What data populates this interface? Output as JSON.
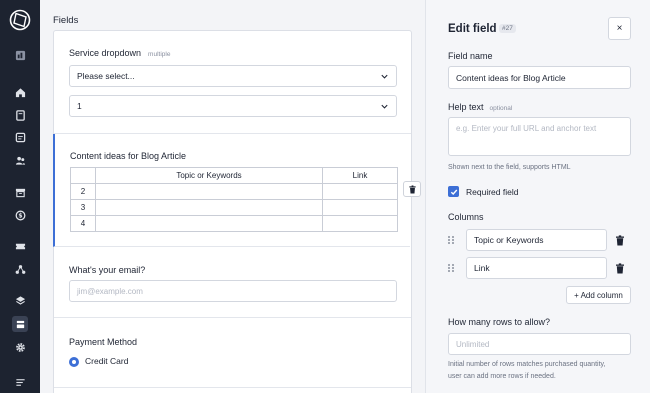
{
  "main": {
    "fields_title": "Fields",
    "service": {
      "label": "Service dropdown",
      "tag": "multiple",
      "select_value": "Please select...",
      "quantity_value": "1"
    },
    "content": {
      "label": "Content ideas for Blog Article",
      "columns": [
        "Topic or Keywords",
        "Link"
      ],
      "rows": [
        "2",
        "3",
        "4"
      ]
    },
    "email": {
      "label": "What's your email?",
      "placeholder": "jim@example.com"
    },
    "payment": {
      "label": "Payment Method",
      "option": "Credit Card"
    }
  },
  "panel": {
    "title": "Edit field",
    "badge": "#27",
    "close": "×",
    "field_name_label": "Field name",
    "field_name_value": "Content ideas for Blog Article",
    "help_text_label": "Help text",
    "help_text_optional": "optional",
    "help_text_placeholder": "e.g. Enter your full URL and anchor text",
    "help_hint": "Shown next to the field, supports HTML",
    "required_label": "Required field",
    "columns_label": "Columns",
    "columns": [
      "Topic or Keywords",
      "Link"
    ],
    "add_column": "+ Add column",
    "rows_label": "How many rows to allow?",
    "rows_placeholder": "Unlimited",
    "rows_hint_1": "Initial number of rows matches purchased quantity,",
    "rows_hint_2": "user can add more rows if needed."
  },
  "sidebar": {
    "icons": [
      "logo-icon",
      "dashboard-icon",
      "home-icon",
      "orders-icon",
      "messages-icon",
      "clients-icon",
      "archive-icon",
      "billing-icon",
      "tickets-icon",
      "team-icon",
      "layers-icon",
      "forms-icon",
      "settings-icon",
      "menu-icon"
    ]
  },
  "colors": {
    "accent": "#3d6fd6",
    "sidebar": "#1d2330"
  }
}
